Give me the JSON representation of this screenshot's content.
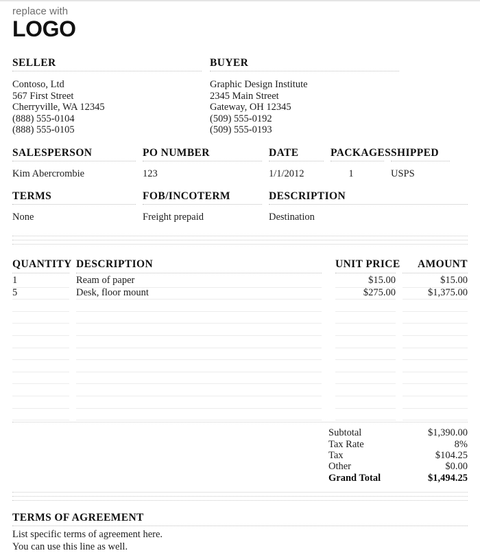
{
  "logo": {
    "tagline": "replace with",
    "word": "LOGO"
  },
  "parties": {
    "seller": {
      "heading": "SELLER",
      "lines": [
        "Contoso, Ltd",
        "567 First Street",
        "Cherryville, WA 12345",
        "(888) 555-0104",
        "(888) 555-0105"
      ]
    },
    "buyer": {
      "heading": "BUYER",
      "lines": [
        "Graphic Design Institute",
        "2345 Main Street",
        "Gateway, OH 12345",
        "(509) 555-0192",
        "(509) 555-0193"
      ]
    }
  },
  "meta_row_1": {
    "salesperson": {
      "label": "SALESPERSON",
      "value": "Kim Abercrombie"
    },
    "po_number": {
      "label": "PO NUMBER",
      "value": "123"
    },
    "date": {
      "label": "DATE",
      "value": "1/1/2012"
    },
    "packages": {
      "label": "PACKAGES",
      "value": "1"
    },
    "shipped": {
      "label": "SHIPPED",
      "value": "USPS"
    }
  },
  "meta_row_2": {
    "terms": {
      "label": "TERMS",
      "value": "None"
    },
    "fob": {
      "label": "FOB/INCOTERM",
      "value": "Freight prepaid"
    },
    "description": {
      "label": "DESCRIPTION",
      "value": "Destination"
    }
  },
  "items_table": {
    "headers": {
      "quantity": "QUANTITY",
      "description": "DESCRIPTION",
      "unit_price": "UNIT PRICE",
      "amount": "AMOUNT"
    },
    "rows": [
      {
        "quantity": "1",
        "description": "Ream of paper",
        "unit_price": "$15.00",
        "amount": "$15.00"
      },
      {
        "quantity": "5",
        "description": "Desk, floor mount",
        "unit_price": "$275.00",
        "amount": "$1,375.00"
      }
    ],
    "empty_row_count": 11
  },
  "totals": [
    {
      "label": "Subtotal",
      "value": "$1,390.00",
      "emphasis": false
    },
    {
      "label": "Tax Rate",
      "value": "8%",
      "emphasis": false
    },
    {
      "label": "Tax",
      "value": "$104.25",
      "emphasis": false
    },
    {
      "label": "Other",
      "value": "$0.00",
      "emphasis": false
    },
    {
      "label": "Grand Total",
      "value": "$1,494.25",
      "emphasis": true
    }
  ],
  "agreement": {
    "heading": "TERMS OF AGREEMENT",
    "lines": [
      "List specific terms of agreement here.",
      "You can use this line as well."
    ]
  },
  "colors": {
    "page_background": "#ffffff",
    "text": "#1d1d1d",
    "heading": "#111111",
    "tagline": "#6e6e6e",
    "dotted_rule": "#bdbdbd",
    "row_rule": "#ececec"
  }
}
